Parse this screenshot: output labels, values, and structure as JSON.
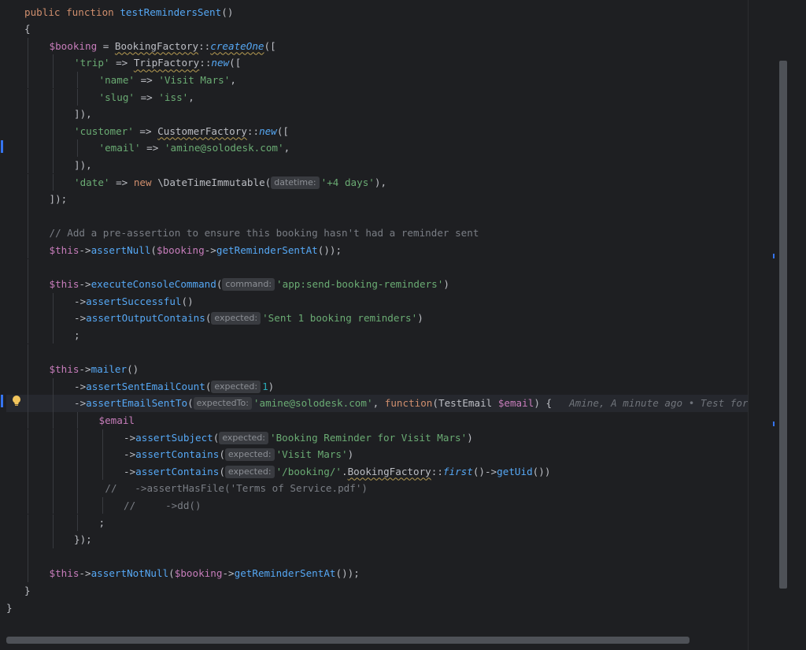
{
  "editor": {
    "lines": [
      {
        "indent": 1,
        "guides": [],
        "tokens": [
          [
            "kw",
            "public "
          ],
          [
            "kw",
            "function "
          ],
          [
            "fn",
            "testRemindersSent"
          ],
          [
            "plain",
            "()"
          ]
        ]
      },
      {
        "indent": 1,
        "guides": [],
        "tokens": [
          [
            "plain",
            "{"
          ]
        ]
      },
      {
        "indent": 2,
        "guides": [
          1
        ],
        "tokens": [
          [
            "var",
            "$booking"
          ],
          [
            "plain",
            " = "
          ],
          [
            "plain wavy",
            "BookingFactory"
          ],
          [
            "plain",
            "::"
          ],
          [
            "fn it wavy",
            "createOne"
          ],
          [
            "plain",
            "(["
          ]
        ]
      },
      {
        "indent": 3,
        "guides": [
          1,
          2
        ],
        "tokens": [
          [
            "str",
            "'trip'"
          ],
          [
            "plain",
            " => "
          ],
          [
            "plain wavy",
            "TripFactory"
          ],
          [
            "plain",
            "::"
          ],
          [
            "fn it",
            "new"
          ],
          [
            "plain",
            "(["
          ]
        ]
      },
      {
        "indent": 4,
        "guides": [
          1,
          2,
          3
        ],
        "tokens": [
          [
            "str",
            "'name'"
          ],
          [
            "plain",
            " => "
          ],
          [
            "str",
            "'Visit Mars'"
          ],
          [
            "plain",
            ","
          ]
        ]
      },
      {
        "indent": 4,
        "guides": [
          1,
          2,
          3
        ],
        "tokens": [
          [
            "str",
            "'slug'"
          ],
          [
            "plain",
            " => "
          ],
          [
            "str",
            "'iss'"
          ],
          [
            "plain",
            ","
          ]
        ]
      },
      {
        "indent": 3,
        "guides": [
          1,
          2
        ],
        "tokens": [
          [
            "plain",
            "]),"
          ]
        ]
      },
      {
        "indent": 3,
        "guides": [
          1,
          2
        ],
        "tokens": [
          [
            "str",
            "'customer'"
          ],
          [
            "plain",
            " => "
          ],
          [
            "plain wavy",
            "CustomerFactory"
          ],
          [
            "plain",
            "::"
          ],
          [
            "fn it",
            "new"
          ],
          [
            "plain",
            "(["
          ]
        ]
      },
      {
        "indent": 4,
        "guides": [
          1,
          2,
          3
        ],
        "tokens": [
          [
            "str",
            "'email'"
          ],
          [
            "plain",
            " => "
          ],
          [
            "str",
            "'amine@solodesk.com'"
          ],
          [
            "plain",
            ","
          ]
        ]
      },
      {
        "indent": 3,
        "guides": [
          1,
          2
        ],
        "tokens": [
          [
            "plain",
            "]),"
          ]
        ]
      },
      {
        "indent": 3,
        "guides": [
          1,
          2
        ],
        "tokens": [
          [
            "str",
            "'date'"
          ],
          [
            "plain",
            " => "
          ],
          [
            "kw",
            "new "
          ],
          [
            "plain",
            "\\DateTimeImmutable("
          ],
          [
            "hint",
            "datetime:"
          ],
          [
            "str",
            "'+4 days'"
          ],
          [
            "plain",
            "),"
          ]
        ]
      },
      {
        "indent": 2,
        "guides": [
          1
        ],
        "tokens": [
          [
            "plain",
            "]);"
          ]
        ]
      },
      {
        "indent": 2,
        "guides": [
          1
        ],
        "tokens": []
      },
      {
        "indent": 2,
        "guides": [
          1
        ],
        "tokens": [
          [
            "cmt",
            "// Add a pre-assertion to ensure this booking hasn't had a reminder sent"
          ]
        ]
      },
      {
        "indent": 2,
        "guides": [
          1
        ],
        "tokens": [
          [
            "var",
            "$this"
          ],
          [
            "plain",
            "->"
          ],
          [
            "fn",
            "assertNull"
          ],
          [
            "plain",
            "("
          ],
          [
            "var",
            "$booking"
          ],
          [
            "plain",
            "->"
          ],
          [
            "fn",
            "getReminderSentAt"
          ],
          [
            "plain",
            "());"
          ]
        ]
      },
      {
        "indent": 2,
        "guides": [
          1
        ],
        "tokens": []
      },
      {
        "indent": 2,
        "guides": [
          1
        ],
        "tokens": [
          [
            "var",
            "$this"
          ],
          [
            "plain",
            "->"
          ],
          [
            "fn",
            "executeConsoleCommand"
          ],
          [
            "plain",
            "("
          ],
          [
            "hint",
            "command:"
          ],
          [
            "str",
            "'app:send-booking-reminders'"
          ],
          [
            "plain",
            ")"
          ]
        ]
      },
      {
        "indent": 3,
        "guides": [
          1,
          2
        ],
        "tokens": [
          [
            "plain",
            "->"
          ],
          [
            "fn",
            "assertSuccessful"
          ],
          [
            "plain",
            "()"
          ]
        ]
      },
      {
        "indent": 3,
        "guides": [
          1,
          2
        ],
        "tokens": [
          [
            "plain",
            "->"
          ],
          [
            "fn",
            "assertOutputContains"
          ],
          [
            "plain",
            "("
          ],
          [
            "hint",
            "expected:"
          ],
          [
            "str",
            "'Sent 1 booking reminders'"
          ],
          [
            "plain",
            ")"
          ]
        ]
      },
      {
        "indent": 3,
        "guides": [
          1,
          2
        ],
        "tokens": [
          [
            "plain",
            ";"
          ]
        ]
      },
      {
        "indent": 2,
        "guides": [
          1
        ],
        "tokens": []
      },
      {
        "indent": 2,
        "guides": [
          1
        ],
        "tokens": [
          [
            "var",
            "$this"
          ],
          [
            "plain",
            "->"
          ],
          [
            "fn",
            "mailer"
          ],
          [
            "plain",
            "()"
          ]
        ]
      },
      {
        "indent": 3,
        "guides": [
          1,
          2
        ],
        "tokens": [
          [
            "plain",
            "->"
          ],
          [
            "fn",
            "assertSentEmailCount"
          ],
          [
            "plain",
            "("
          ],
          [
            "hint",
            "expected:"
          ],
          [
            "num",
            "1"
          ],
          [
            "plain",
            ")"
          ]
        ]
      },
      {
        "indent": 3,
        "guides": [
          1,
          2
        ],
        "current": true,
        "tokens": [
          [
            "plain",
            "->"
          ],
          [
            "fn",
            "assertEmailSentTo"
          ],
          [
            "plain",
            "("
          ],
          [
            "hint",
            "expectedTo:"
          ],
          [
            "str",
            "'amine@solodesk.com'"
          ],
          [
            "plain",
            ", "
          ],
          [
            "kw",
            "function"
          ],
          [
            "plain",
            "(TestEmail "
          ],
          [
            "var",
            "$email"
          ],
          [
            "plain",
            ") {"
          ],
          [
            "blame",
            "Amine, A minute ago • Test for C"
          ]
        ]
      },
      {
        "indent": 4,
        "guides": [
          1,
          2,
          3
        ],
        "tokens": [
          [
            "var",
            "$email"
          ]
        ]
      },
      {
        "indent": 5,
        "guides": [
          1,
          2,
          3,
          4
        ],
        "tokens": [
          [
            "plain",
            "->"
          ],
          [
            "fn",
            "assertSubject"
          ],
          [
            "plain",
            "("
          ],
          [
            "hint",
            "expected:"
          ],
          [
            "str",
            "'Booking Reminder for Visit Mars'"
          ],
          [
            "plain",
            ")"
          ]
        ]
      },
      {
        "indent": 5,
        "guides": [
          1,
          2,
          3,
          4
        ],
        "tokens": [
          [
            "plain",
            "->"
          ],
          [
            "fn",
            "assertContains"
          ],
          [
            "plain",
            "("
          ],
          [
            "hint",
            "expected:"
          ],
          [
            "str",
            "'Visit Mars'"
          ],
          [
            "plain",
            ")"
          ]
        ]
      },
      {
        "indent": 5,
        "guides": [
          1,
          2,
          3,
          4
        ],
        "tokens": [
          [
            "plain",
            "->"
          ],
          [
            "fn",
            "assertContains"
          ],
          [
            "plain",
            "("
          ],
          [
            "hint",
            "expected:"
          ],
          [
            "str",
            "'/booking/'"
          ],
          [
            "plain",
            "."
          ],
          [
            "plain wavy",
            "BookingFactory"
          ],
          [
            "plain",
            "::"
          ],
          [
            "fn it",
            "first"
          ],
          [
            "plain",
            "()->"
          ],
          [
            "fn",
            "getUid"
          ],
          [
            "plain",
            "())"
          ]
        ]
      },
      {
        "indent": 4.25,
        "guides": [
          1,
          2,
          3
        ],
        "tokens": [
          [
            "cmt",
            "//   ->assertHasFile('Terms of Service.pdf')"
          ]
        ]
      },
      {
        "indent": 5,
        "guides": [
          1,
          2,
          3,
          4
        ],
        "tokens": [
          [
            "cmt",
            "//     ->dd()"
          ]
        ]
      },
      {
        "indent": 4,
        "guides": [
          1,
          2,
          3
        ],
        "tokens": [
          [
            "plain",
            ";"
          ]
        ]
      },
      {
        "indent": 3,
        "guides": [
          1,
          2
        ],
        "tokens": [
          [
            "plain",
            "});"
          ]
        ]
      },
      {
        "indent": 2,
        "guides": [
          1
        ],
        "tokens": []
      },
      {
        "indent": 2,
        "guides": [
          1
        ],
        "tokens": [
          [
            "var",
            "$this"
          ],
          [
            "plain",
            "->"
          ],
          [
            "fn",
            "assertNotNull"
          ],
          [
            "plain",
            "("
          ],
          [
            "var",
            "$booking"
          ],
          [
            "plain",
            "->"
          ],
          [
            "fn",
            "getReminderSentAt"
          ],
          [
            "plain",
            "());"
          ]
        ]
      },
      {
        "indent": 1,
        "guides": [],
        "tokens": [
          [
            "plain",
            "}"
          ]
        ]
      },
      {
        "indent": 0,
        "guides": [],
        "tokens": [
          [
            "plain",
            "}"
          ]
        ]
      }
    ]
  }
}
